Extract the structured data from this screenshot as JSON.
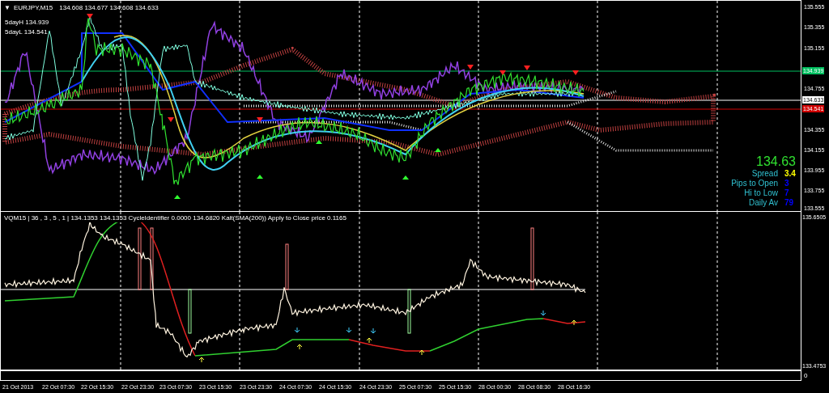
{
  "main_chart": {
    "menu_marker": "▼",
    "symbol": "EURJPY,M15",
    "quote": [
      "134.608",
      "134.677",
      "134.608",
      "134.633"
    ],
    "levels": [
      "5dayH 134.939",
      "5dayL 134.541"
    ],
    "info": {
      "price": "134.63",
      "rows": [
        {
          "label": "Spread",
          "value": "3.4",
          "color": "#ffff00"
        },
        {
          "label": "Pips to Open",
          "value": "3",
          "color": "#0000ff"
        },
        {
          "label": "Hi to Low",
          "value": "7",
          "color": "#0000ff"
        },
        {
          "label": "Daily Av",
          "value": "79",
          "color": "#0000ff"
        }
      ]
    },
    "price_axis": [
      {
        "label": "135.555",
        "kind": "tick"
      },
      {
        "label": "135.355",
        "kind": "tick"
      },
      {
        "label": "135.155",
        "kind": "tick"
      },
      {
        "label": "134.939",
        "kind": "marker",
        "color": "#00c060"
      },
      {
        "label": "134.755",
        "kind": "tick"
      },
      {
        "label": "134.633",
        "kind": "marker",
        "color": "#ffffff"
      },
      {
        "label": "134.541",
        "kind": "marker",
        "color": "#d00000"
      },
      {
        "label": "134.355",
        "kind": "tick"
      },
      {
        "label": "134.155",
        "kind": "tick"
      },
      {
        "label": "133.955",
        "kind": "tick"
      },
      {
        "label": "133.755",
        "kind": "tick"
      },
      {
        "label": "133.555",
        "kind": "tick"
      }
    ]
  },
  "indicator": {
    "header": "VQM15 | 36 , 3 , 5 , 1 | 134.1353 134.1353 CycleIdentifier 0.0000 134.6820 Kalt(SMA(200)) Apply to Close price 0.1165",
    "axis": [
      "135.6505",
      "133.4753"
    ]
  },
  "sub_window": {
    "axis": "0"
  },
  "time_axis": [
    "21 Oct 2013",
    "22 Oct 07:30",
    "22 Oct 15:30",
    "22 Oct 23:30",
    "23 Oct 07:30",
    "23 Oct 15:30",
    "23 Oct 23:30",
    "24 Oct 07:30",
    "24 Oct 15:30",
    "24 Oct 23:30",
    "25 Oct 07:30",
    "25 Oct 15:30",
    "28 Oct 00:30",
    "28 Oct 08:30",
    "28 Oct 16:30"
  ]
}
